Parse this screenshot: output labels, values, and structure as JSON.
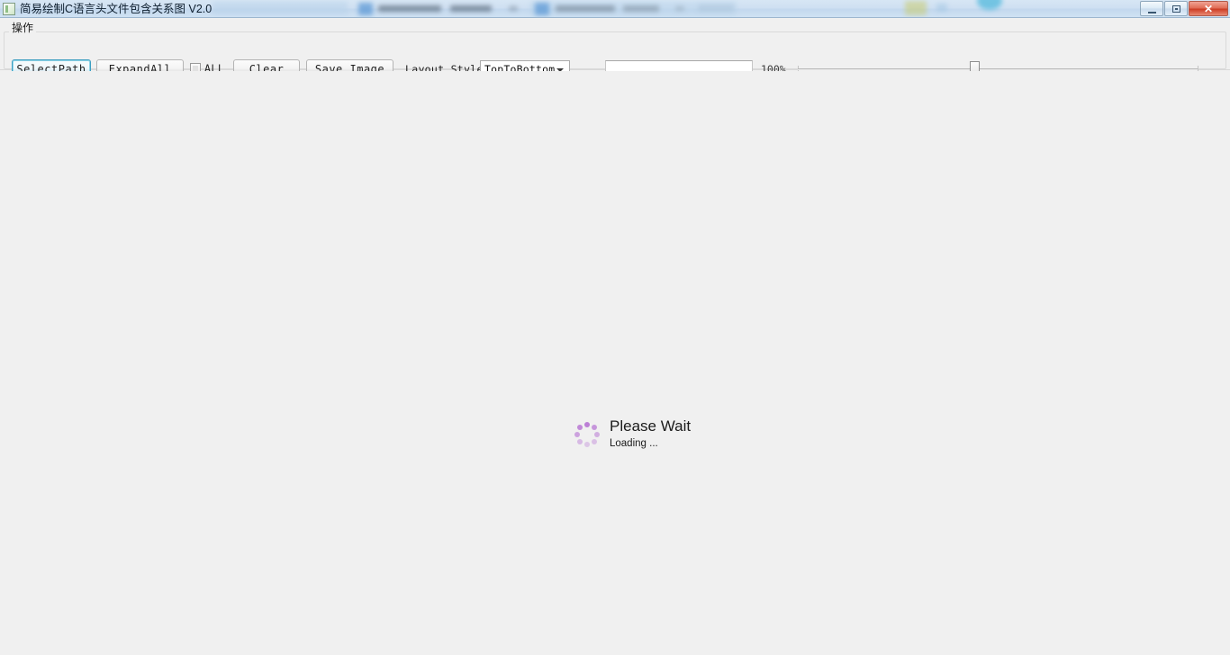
{
  "window": {
    "title": "简易绘制C语言头文件包含关系图 V2.0",
    "icon": "app-document-icon",
    "controls": {
      "minimize_label": "",
      "restore_label": "",
      "close_label": "✕"
    }
  },
  "toolbar": {
    "group_legend": "操作",
    "select_path_label": "SelectPath",
    "expand_all_label": "ExpandAll",
    "all_checkbox_label": "ALL",
    "all_checkbox_checked": false,
    "clear_label": "Clear",
    "save_image_label": "Save Image",
    "layout_style_label": "Layout Style:",
    "layout_style_value": "TopToBottom",
    "layout_style_options": [
      "TopToBottom"
    ],
    "path_input_value": "",
    "path_input_placeholder": "",
    "zoom_percent_label": "100%",
    "zoom_slider_value": 44
  },
  "canvas": {
    "loading_title": "Please Wait",
    "loading_subtitle": "Loading ...",
    "spinner_color": "#b878d4",
    "background_color": "#f0f0f0"
  }
}
